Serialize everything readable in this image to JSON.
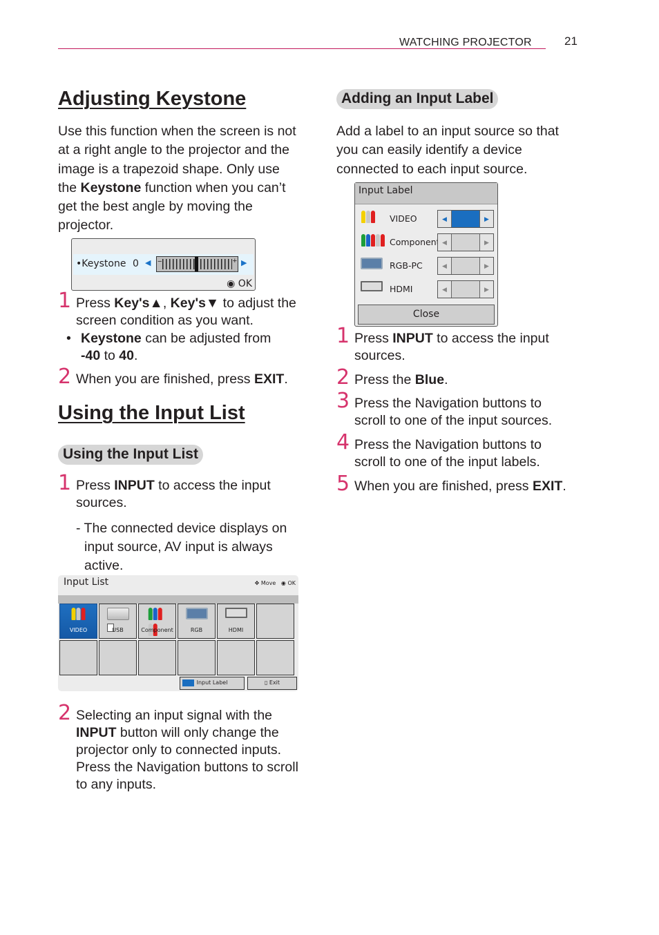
{
  "header": {
    "section": "WATCHING PROJECTOR",
    "page_number": "21"
  },
  "keystone": {
    "title": "Adjusting Keystone",
    "intro_parts": [
      "Use this function when the screen is not at a right angle to the projector and the image is a trapezoid shape. Only use the ",
      "Keystone",
      " function when you can’t get the best angle by moving the projector."
    ],
    "osd": {
      "label": "•Keystone",
      "value": "0",
      "ok_label": "OK",
      "level_fraction": 0.5,
      "range": [
        -40,
        40
      ]
    },
    "steps": [
      {
        "num": "1",
        "parts": [
          "Press ",
          "Key's▲",
          ", ",
          "Key's▼",
          " to adjust the screen condition as you want."
        ]
      },
      {
        "num": "2",
        "parts": [
          "When you are finished, press ",
          "EXIT",
          "."
        ]
      }
    ],
    "note": {
      "parts": [
        "Keystone",
        " can be adjusted from ",
        "-40",
        " to ",
        "40",
        "."
      ]
    }
  },
  "input_list": {
    "title": "Using the Input List",
    "subtitle": "Using the Input List",
    "steps": [
      {
        "num": "1",
        "parts": [
          "Press ",
          "INPUT",
          " to access the input sources."
        ],
        "subnote": "- The connected device displays on input source, AV input is always active."
      },
      {
        "num": "2",
        "parts": [
          "Selecting an input signal with the ",
          "INPUT",
          " button will only change the projector only to connected inputs. Press the Navigation buttons to scroll to any inputs."
        ]
      }
    ],
    "osd": {
      "title": "Input List",
      "hint_move": "Move",
      "hint_ok": "OK",
      "cells": [
        {
          "label": "VIDEO",
          "icon": "rca-video-icon",
          "selected": true
        },
        {
          "label": "USB",
          "icon": "usb-icon",
          "selected": false
        },
        {
          "label": "Component",
          "icon": "component-icon",
          "selected": false
        },
        {
          "label": "RGB",
          "icon": "vga-icon",
          "selected": false
        },
        {
          "label": "HDMI",
          "icon": "hdmi-icon",
          "selected": false
        },
        {
          "label": "",
          "icon": "",
          "selected": false
        },
        {
          "label": "",
          "icon": "",
          "selected": false
        },
        {
          "label": "",
          "icon": "",
          "selected": false
        },
        {
          "label": "",
          "icon": "",
          "selected": false
        },
        {
          "label": "",
          "icon": "",
          "selected": false
        },
        {
          "label": "",
          "icon": "",
          "selected": false
        },
        {
          "label": "",
          "icon": "",
          "selected": false
        }
      ],
      "input_label_button": "Input Label",
      "exit_button": "Exit"
    }
  },
  "input_label": {
    "subtitle": "Adding an Input Label",
    "intro": "Add a label to an input source so that you can easily identify a device connected to each input source.",
    "osd": {
      "title": "Input Label",
      "rows": [
        {
          "name": "VIDEO",
          "icon": "rca-video-icon",
          "active": true
        },
        {
          "name": "Component",
          "icon": "component-icon",
          "active": false
        },
        {
          "name": "RGB-PC",
          "icon": "vga-icon",
          "active": false
        },
        {
          "name": "HDMI",
          "icon": "hdmi-icon",
          "active": false
        }
      ],
      "close_button": "Close"
    },
    "steps": [
      {
        "num": "1",
        "parts": [
          "Press ",
          "INPUT",
          " to access the input sources."
        ]
      },
      {
        "num": "2",
        "parts": [
          "Press the ",
          "Blue",
          "."
        ]
      },
      {
        "num": "3",
        "parts": [
          "Press the Navigation buttons to scroll to one of the input sources."
        ]
      },
      {
        "num": "4",
        "parts": [
          "Press the Navigation buttons to scroll to one of the input labels."
        ]
      },
      {
        "num": "5",
        "parts": [
          "When you are finished, press ",
          "EXIT",
          "."
        ]
      }
    ]
  },
  "colors": {
    "accent": "#d6336c",
    "rule": "#c2185b",
    "selection_blue": "#1a6ec0",
    "pill_bg": "#d6d6d6"
  }
}
